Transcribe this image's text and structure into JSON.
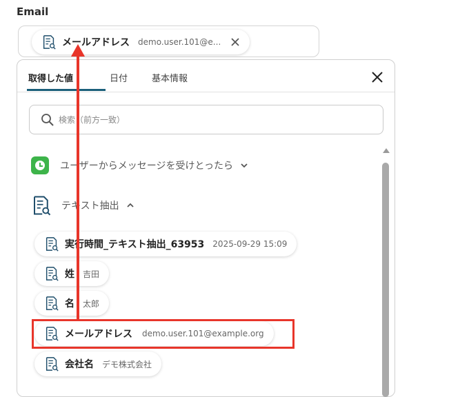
{
  "field": {
    "label": "Email",
    "selected_chip": {
      "label": "メールアドレス",
      "value": "demo.user.101@e..."
    }
  },
  "dropdown": {
    "tabs": [
      {
        "label": "取得した値",
        "active": true
      },
      {
        "label": "日付",
        "active": false
      },
      {
        "label": "基本情報",
        "active": false
      }
    ],
    "search_placeholder": "検索（前方一致）",
    "sections": [
      {
        "label": "ユーザーからメッセージを受けとったら",
        "icon": "line-clock-icon",
        "expanded": false
      },
      {
        "label": "テキスト抽出",
        "icon": "document-search-icon",
        "expanded": true
      }
    ],
    "items": [
      {
        "label": "実行時間_テキスト抽出_63953",
        "value": "2025-09-29 15:09"
      },
      {
        "label": "姓",
        "value": "吉田"
      },
      {
        "label": "名",
        "value": "太郎"
      },
      {
        "label": "メールアドレス",
        "value": "demo.user.101@example.org"
      },
      {
        "label": "会社名",
        "value": "デモ株式会社"
      }
    ]
  },
  "colors": {
    "accent": "#1a5f7a",
    "highlight": "#e8352a",
    "line_green": "#3db44a"
  }
}
